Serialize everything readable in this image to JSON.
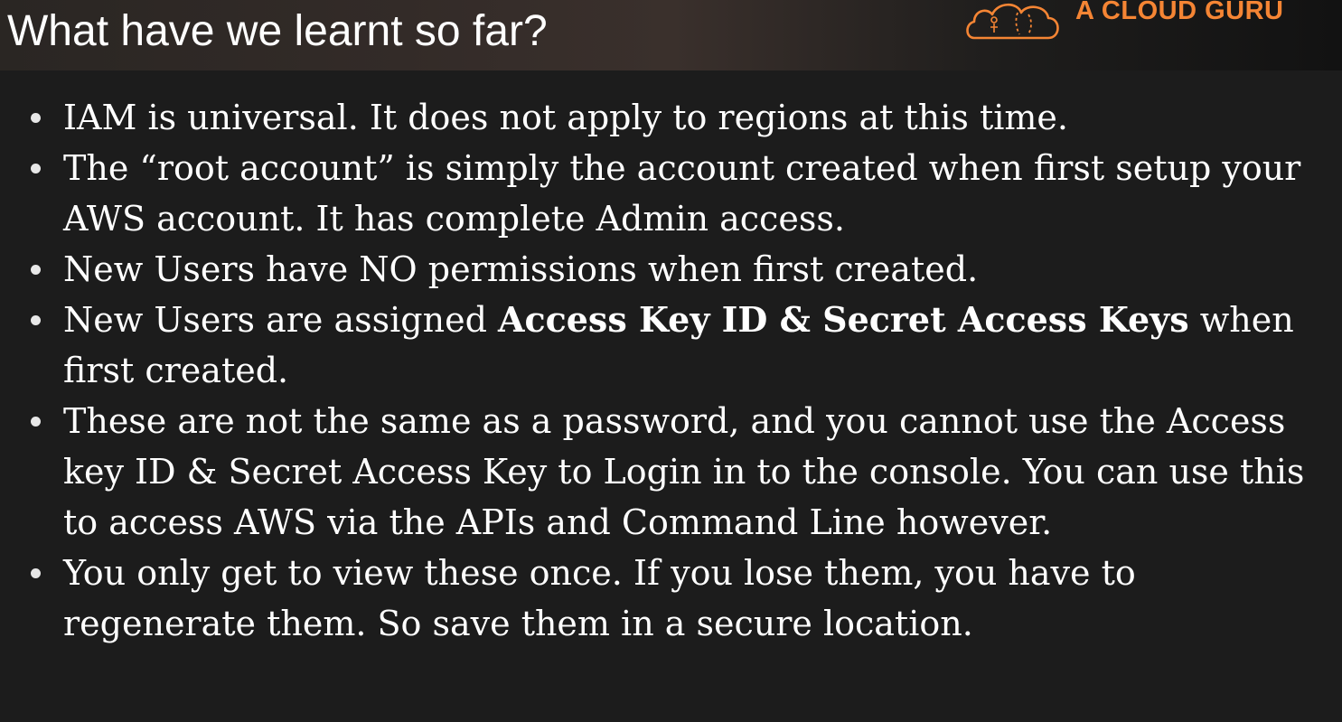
{
  "slide": {
    "title": "What have we learnt so far?",
    "brand": {
      "name": "A CLOUD GURU",
      "icon": "cloud-logo-icon",
      "color": "#f58534"
    },
    "bullets": [
      {
        "parts": [
          {
            "text": "IAM is universal. It does not apply to regions at this time.",
            "bold": false
          }
        ]
      },
      {
        "parts": [
          {
            "text": "The “root account” is simply the account created when first setup your AWS account. It has complete Admin access.",
            "bold": false
          }
        ]
      },
      {
        "parts": [
          {
            "text": "New Users have NO permissions when first created.",
            "bold": false
          }
        ]
      },
      {
        "parts": [
          {
            "text": "New Users are assigned ",
            "bold": false
          },
          {
            "text": "Access Key ID & Secret Access Keys",
            "bold": true
          },
          {
            "text": " when first created.",
            "bold": false
          }
        ]
      },
      {
        "parts": [
          {
            "text": "These are not the same as a password, and you cannot use the Access key ID & Secret Access Key to Login in to the console. You can use this to access AWS via the APIs and Command Line however.",
            "bold": false
          }
        ]
      },
      {
        "parts": [
          {
            "text": "You only get to view these once. If you lose them, you have to regenerate them. So save them in a secure location.",
            "bold": false
          }
        ]
      }
    ]
  }
}
